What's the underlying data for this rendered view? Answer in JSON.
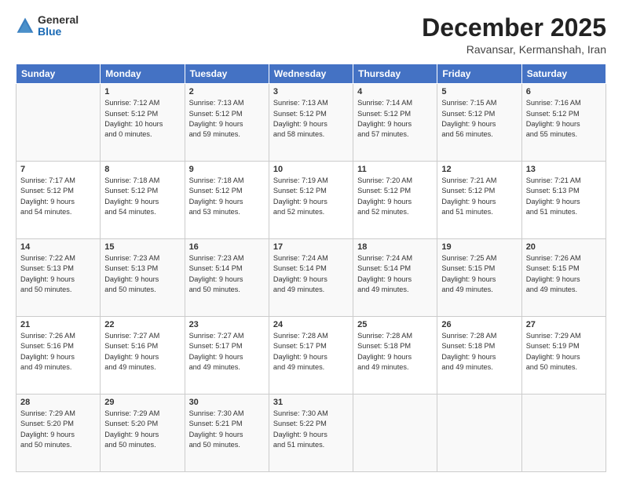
{
  "logo": {
    "general": "General",
    "blue": "Blue"
  },
  "header": {
    "month": "December 2025",
    "location": "Ravansar, Kermanshah, Iran"
  },
  "weekdays": [
    "Sunday",
    "Monday",
    "Tuesday",
    "Wednesday",
    "Thursday",
    "Friday",
    "Saturday"
  ],
  "weeks": [
    [
      {
        "day": "",
        "info": ""
      },
      {
        "day": "1",
        "info": "Sunrise: 7:12 AM\nSunset: 5:12 PM\nDaylight: 10 hours\nand 0 minutes."
      },
      {
        "day": "2",
        "info": "Sunrise: 7:13 AM\nSunset: 5:12 PM\nDaylight: 9 hours\nand 59 minutes."
      },
      {
        "day": "3",
        "info": "Sunrise: 7:13 AM\nSunset: 5:12 PM\nDaylight: 9 hours\nand 58 minutes."
      },
      {
        "day": "4",
        "info": "Sunrise: 7:14 AM\nSunset: 5:12 PM\nDaylight: 9 hours\nand 57 minutes."
      },
      {
        "day": "5",
        "info": "Sunrise: 7:15 AM\nSunset: 5:12 PM\nDaylight: 9 hours\nand 56 minutes."
      },
      {
        "day": "6",
        "info": "Sunrise: 7:16 AM\nSunset: 5:12 PM\nDaylight: 9 hours\nand 55 minutes."
      }
    ],
    [
      {
        "day": "7",
        "info": "Sunrise: 7:17 AM\nSunset: 5:12 PM\nDaylight: 9 hours\nand 54 minutes."
      },
      {
        "day": "8",
        "info": "Sunrise: 7:18 AM\nSunset: 5:12 PM\nDaylight: 9 hours\nand 54 minutes."
      },
      {
        "day": "9",
        "info": "Sunrise: 7:18 AM\nSunset: 5:12 PM\nDaylight: 9 hours\nand 53 minutes."
      },
      {
        "day": "10",
        "info": "Sunrise: 7:19 AM\nSunset: 5:12 PM\nDaylight: 9 hours\nand 52 minutes."
      },
      {
        "day": "11",
        "info": "Sunrise: 7:20 AM\nSunset: 5:12 PM\nDaylight: 9 hours\nand 52 minutes."
      },
      {
        "day": "12",
        "info": "Sunrise: 7:21 AM\nSunset: 5:12 PM\nDaylight: 9 hours\nand 51 minutes."
      },
      {
        "day": "13",
        "info": "Sunrise: 7:21 AM\nSunset: 5:13 PM\nDaylight: 9 hours\nand 51 minutes."
      }
    ],
    [
      {
        "day": "14",
        "info": "Sunrise: 7:22 AM\nSunset: 5:13 PM\nDaylight: 9 hours\nand 50 minutes."
      },
      {
        "day": "15",
        "info": "Sunrise: 7:23 AM\nSunset: 5:13 PM\nDaylight: 9 hours\nand 50 minutes."
      },
      {
        "day": "16",
        "info": "Sunrise: 7:23 AM\nSunset: 5:14 PM\nDaylight: 9 hours\nand 50 minutes."
      },
      {
        "day": "17",
        "info": "Sunrise: 7:24 AM\nSunset: 5:14 PM\nDaylight: 9 hours\nand 49 minutes."
      },
      {
        "day": "18",
        "info": "Sunrise: 7:24 AM\nSunset: 5:14 PM\nDaylight: 9 hours\nand 49 minutes."
      },
      {
        "day": "19",
        "info": "Sunrise: 7:25 AM\nSunset: 5:15 PM\nDaylight: 9 hours\nand 49 minutes."
      },
      {
        "day": "20",
        "info": "Sunrise: 7:26 AM\nSunset: 5:15 PM\nDaylight: 9 hours\nand 49 minutes."
      }
    ],
    [
      {
        "day": "21",
        "info": "Sunrise: 7:26 AM\nSunset: 5:16 PM\nDaylight: 9 hours\nand 49 minutes."
      },
      {
        "day": "22",
        "info": "Sunrise: 7:27 AM\nSunset: 5:16 PM\nDaylight: 9 hours\nand 49 minutes."
      },
      {
        "day": "23",
        "info": "Sunrise: 7:27 AM\nSunset: 5:17 PM\nDaylight: 9 hours\nand 49 minutes."
      },
      {
        "day": "24",
        "info": "Sunrise: 7:28 AM\nSunset: 5:17 PM\nDaylight: 9 hours\nand 49 minutes."
      },
      {
        "day": "25",
        "info": "Sunrise: 7:28 AM\nSunset: 5:18 PM\nDaylight: 9 hours\nand 49 minutes."
      },
      {
        "day": "26",
        "info": "Sunrise: 7:28 AM\nSunset: 5:18 PM\nDaylight: 9 hours\nand 49 minutes."
      },
      {
        "day": "27",
        "info": "Sunrise: 7:29 AM\nSunset: 5:19 PM\nDaylight: 9 hours\nand 50 minutes."
      }
    ],
    [
      {
        "day": "28",
        "info": "Sunrise: 7:29 AM\nSunset: 5:20 PM\nDaylight: 9 hours\nand 50 minutes."
      },
      {
        "day": "29",
        "info": "Sunrise: 7:29 AM\nSunset: 5:20 PM\nDaylight: 9 hours\nand 50 minutes."
      },
      {
        "day": "30",
        "info": "Sunrise: 7:30 AM\nSunset: 5:21 PM\nDaylight: 9 hours\nand 50 minutes."
      },
      {
        "day": "31",
        "info": "Sunrise: 7:30 AM\nSunset: 5:22 PM\nDaylight: 9 hours\nand 51 minutes."
      },
      {
        "day": "",
        "info": ""
      },
      {
        "day": "",
        "info": ""
      },
      {
        "day": "",
        "info": ""
      }
    ]
  ]
}
